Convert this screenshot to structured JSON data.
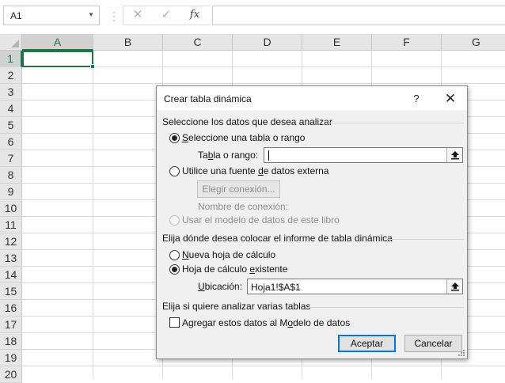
{
  "formula_bar": {
    "name_box_value": "A1",
    "cancel_icon": "✕",
    "enter_icon": "✓",
    "fx_label": "fx",
    "formula_value": ""
  },
  "grid": {
    "columns": [
      "A",
      "B",
      "C",
      "D",
      "E",
      "F",
      "G"
    ],
    "rows": [
      "1",
      "2",
      "3",
      "4",
      "5",
      "6",
      "7",
      "8",
      "9",
      "10",
      "11",
      "12",
      "13",
      "14",
      "15",
      "16",
      "17",
      "18",
      "19",
      "20"
    ],
    "selected_cell": "A1",
    "accent_color": "#217346"
  },
  "dialog": {
    "title": "Crear tabla dinámica",
    "help_label": "?",
    "close_label": "✕",
    "section1_label": "Seleccione los datos que desea analizar",
    "option_table_pre": "",
    "option_table_accel": "S",
    "option_table_post": "eleccione una tabla o rango",
    "table_range_label_pre": "Ta",
    "table_range_label_accel": "b",
    "table_range_label_post": "la o rango:",
    "table_range_value": "",
    "option_external_pre": "Utilice una fuente ",
    "option_external_accel": "d",
    "option_external_post": "e datos externa",
    "choose_connection_label": "Elegir conexión...",
    "connection_name_label": "Nombre de conexión:",
    "option_data_model": "Usar el modelo de datos de este libro",
    "section2_label": "Elija dónde desea colocar el informe de tabla dinámica",
    "option_new_sheet_pre": "",
    "option_new_sheet_accel": "N",
    "option_new_sheet_post": "ueva hoja de cálculo",
    "option_existing_sheet_pre": "Hoja de cálculo ",
    "option_existing_sheet_accel": "e",
    "option_existing_sheet_post": "xistente",
    "location_label_pre": "",
    "location_label_accel": "U",
    "location_label_post": "bicación:",
    "location_value": "Hoja1!$A$1",
    "section3_label": "Elija si quiere analizar varias tablas",
    "add_to_model_pre": "Agregar estos datos al M",
    "add_to_model_accel": "o",
    "add_to_model_post": "delo de datos",
    "ok_label": "Aceptar",
    "cancel_label": "Cancelar"
  }
}
